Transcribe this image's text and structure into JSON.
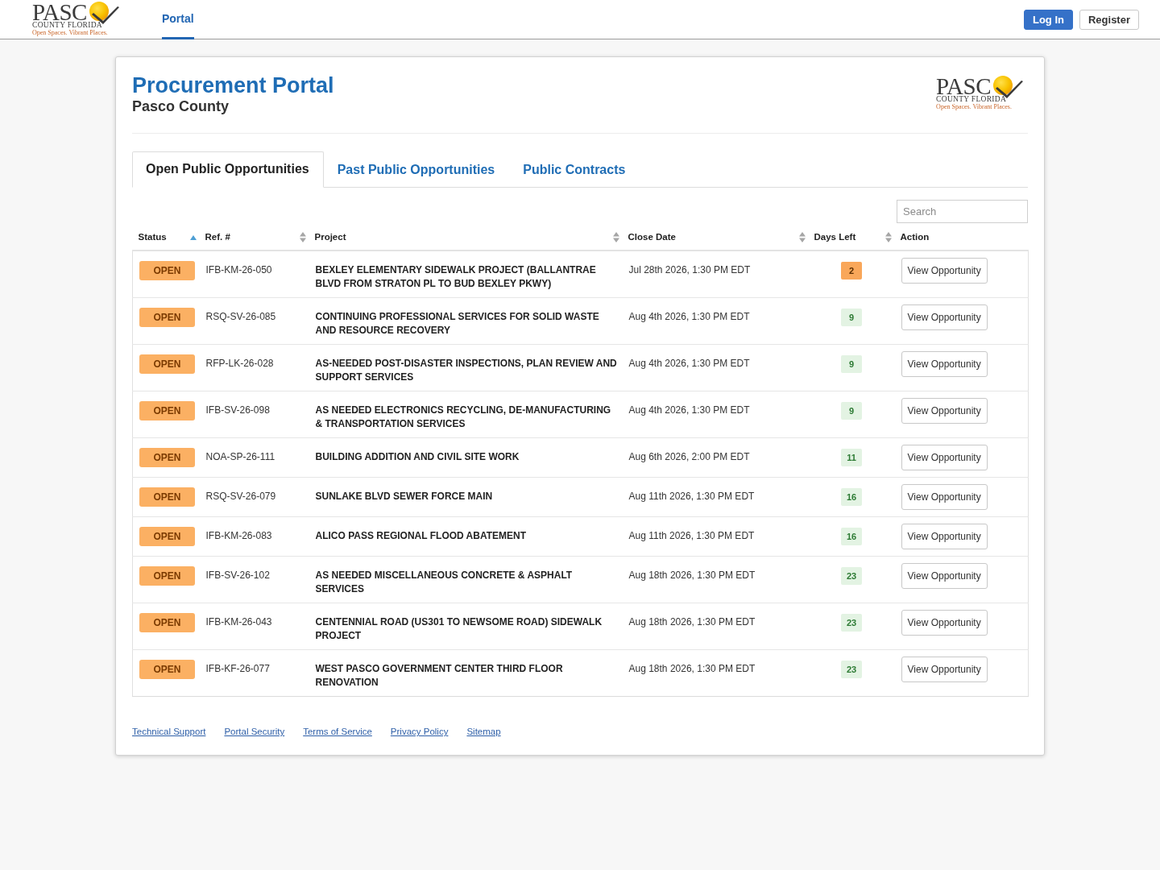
{
  "navbar": {
    "logo": {
      "wordmark": "PASC",
      "subtitle": "COUNTY FLORIDA",
      "tagline": "Open Spaces. Vibrant Places."
    },
    "links": [
      {
        "label": "Portal",
        "selected": true
      }
    ],
    "buttons": [
      {
        "label": "Log In",
        "kind": "primary"
      },
      {
        "label": "Register",
        "kind": "secondary"
      }
    ]
  },
  "header": {
    "title": "Procurement Portal",
    "subtitle": "Pasco County",
    "logo": {
      "wordmark": "PASC",
      "subtitle": "COUNTY FLORIDA",
      "tagline": "Open Spaces. Vibrant Places."
    }
  },
  "tabs": [
    {
      "label": "Open Public Opportunities",
      "selected": true
    },
    {
      "label": "Past Public Opportunities",
      "selected": false
    },
    {
      "label": "Public Contracts",
      "selected": false
    }
  ],
  "search": {
    "placeholder": "Search"
  },
  "table": {
    "columns": [
      {
        "label": "Status",
        "sortable": true,
        "sorted": true
      },
      {
        "label": "Ref. #",
        "sortable": true,
        "sorted": false
      },
      {
        "label": "Project",
        "sortable": true,
        "sorted": false
      },
      {
        "label": "Close Date",
        "sortable": true,
        "sorted": false
      },
      {
        "label": "Days Left",
        "sortable": true,
        "sorted": false
      },
      {
        "label": "Action",
        "sortable": false
      }
    ],
    "rows": [
      {
        "status": "OPEN",
        "ref": "IFB-KM-26-050",
        "project": "BEXLEY ELEMENTARY SIDEWALK PROJECT (BALLANTRAE BLVD FROM STRATON PL TO BUD BEXLEY PKWY)",
        "close_date": "Jul 28th 2026, 1:30 PM EDT",
        "days_left": "2",
        "urgent": true,
        "action": "View Opportunity"
      },
      {
        "status": "OPEN",
        "ref": "RSQ-SV-26-085",
        "project": "CONTINUING PROFESSIONAL SERVICES FOR SOLID WASTE AND RESOURCE RECOVERY",
        "close_date": "Aug 4th 2026, 1:30 PM EDT",
        "days_left": "9",
        "urgent": false,
        "action": "View Opportunity"
      },
      {
        "status": "OPEN",
        "ref": "RFP-LK-26-028",
        "project": "AS-NEEDED POST-DISASTER INSPECTIONS, PLAN REVIEW AND SUPPORT SERVICES",
        "close_date": "Aug 4th 2026, 1:30 PM EDT",
        "days_left": "9",
        "urgent": false,
        "action": "View Opportunity"
      },
      {
        "status": "OPEN",
        "ref": "IFB-SV-26-098",
        "project": "AS NEEDED ELECTRONICS RECYCLING, DE-MANUFACTURING & TRANSPORTATION SERVICES",
        "close_date": "Aug 4th 2026, 1:30 PM EDT",
        "days_left": "9",
        "urgent": false,
        "action": "View Opportunity"
      },
      {
        "status": "OPEN",
        "ref": "NOA-SP-26-111",
        "project": "BUILDING ADDITION AND CIVIL SITE WORK",
        "close_date": "Aug 6th 2026, 2:00 PM EDT",
        "days_left": "11",
        "urgent": false,
        "action": "View Opportunity"
      },
      {
        "status": "OPEN",
        "ref": "RSQ-SV-26-079",
        "project": "SUNLAKE BLVD SEWER FORCE MAIN",
        "close_date": "Aug 11th 2026, 1:30 PM EDT",
        "days_left": "16",
        "urgent": false,
        "action": "View Opportunity"
      },
      {
        "status": "OPEN",
        "ref": "IFB-KM-26-083",
        "project": "ALICO PASS REGIONAL FLOOD ABATEMENT",
        "close_date": "Aug 11th 2026, 1:30 PM EDT",
        "days_left": "16",
        "urgent": false,
        "action": "View Opportunity"
      },
      {
        "status": "OPEN",
        "ref": "IFB-SV-26-102",
        "project": "AS NEEDED MISCELLANEOUS CONCRETE & ASPHALT SERVICES",
        "close_date": "Aug 18th 2026, 1:30 PM EDT",
        "days_left": "23",
        "urgent": false,
        "action": "View Opportunity"
      },
      {
        "status": "OPEN",
        "ref": "IFB-KM-26-043",
        "project": "CENTENNIAL ROAD (US301 TO NEWSOME ROAD) SIDEWALK PROJECT",
        "close_date": "Aug 18th 2026, 1:30 PM EDT",
        "days_left": "23",
        "urgent": false,
        "action": "View Opportunity"
      },
      {
        "status": "OPEN",
        "ref": "IFB-KF-26-077",
        "project": "WEST PASCO GOVERNMENT CENTER THIRD FLOOR RENOVATION",
        "close_date": "Aug 18th 2026, 1:30 PM EDT",
        "days_left": "23",
        "urgent": false,
        "action": "View Opportunity"
      }
    ]
  },
  "footer_links": [
    "Technical Support",
    "Portal Security",
    "Terms of Service",
    "Privacy Policy",
    "Sitemap"
  ]
}
